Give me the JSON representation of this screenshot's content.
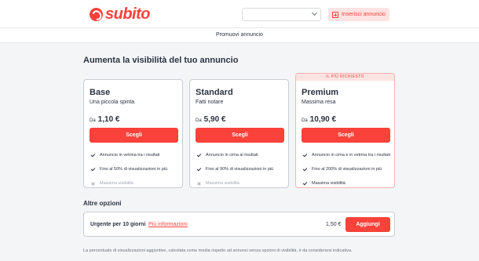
{
  "header": {
    "logo_text": "subito",
    "select_value": "",
    "insert_button_label": "Inserisci annuncio"
  },
  "subbar": {
    "title": "Promuovi annuncio"
  },
  "main": {
    "title": "Aumenta la visibilità del tuo annuncio",
    "plans": [
      {
        "name": "Base",
        "subtitle": "Una piccola spinta",
        "price_prefix": "Da",
        "price": "1,10 €",
        "button_label": "Scegli",
        "features": [
          {
            "text": "Annuncio in vetrina tra i risultati",
            "included": true
          },
          {
            "text": "Fino al 50% di visualizzazioni in più",
            "included": true
          },
          {
            "text": "Massima visibilità",
            "included": false
          }
        ]
      },
      {
        "name": "Standard",
        "subtitle": "Fatti notare",
        "price_prefix": "Da",
        "price": "5,90 €",
        "button_label": "Scegli",
        "features": [
          {
            "text": "Annuncio in cima ai risultati",
            "included": true
          },
          {
            "text": "Fino al 90% di visualizzazioni in più",
            "included": true
          },
          {
            "text": "Massima visibilità",
            "included": false
          }
        ]
      },
      {
        "name": "Premium",
        "ribbon": "IL PIÙ RICHIESTO",
        "subtitle": "Massima resa",
        "price_prefix": "Da",
        "price": "10,90 €",
        "button_label": "Scegli",
        "features": [
          {
            "text": "Annuncio in cima e in vetrina tra i risultati",
            "included": true
          },
          {
            "text": "Fino al 200% di visualizzazioni in più",
            "included": true
          },
          {
            "text": "Massima visibilità",
            "included": true
          }
        ]
      }
    ]
  },
  "other_options": {
    "title": "Altre opzioni",
    "urgent": {
      "label": "Urgente per 10 giorni",
      "link_label": "Più informazioni",
      "price": "1,50 €",
      "button_label": "Aggiungi"
    }
  },
  "footnote": "La percentuale di visualizzazioni aggiuntive, calcolata come media rispetto ad annunci senza opzioni di visibilità, è da considerarsi indicativa.",
  "colors": {
    "accent": "#f9423a",
    "accent_light": "#fde3e2",
    "text": "#2c3342",
    "muted": "#a3a8b3",
    "background": "#f4f5f7"
  },
  "icons": {
    "logo": "subito-logo-icon",
    "insert": "plus-square-icon",
    "select": "chevron-down-icon",
    "included": "check-icon",
    "excluded": "cross-icon"
  }
}
